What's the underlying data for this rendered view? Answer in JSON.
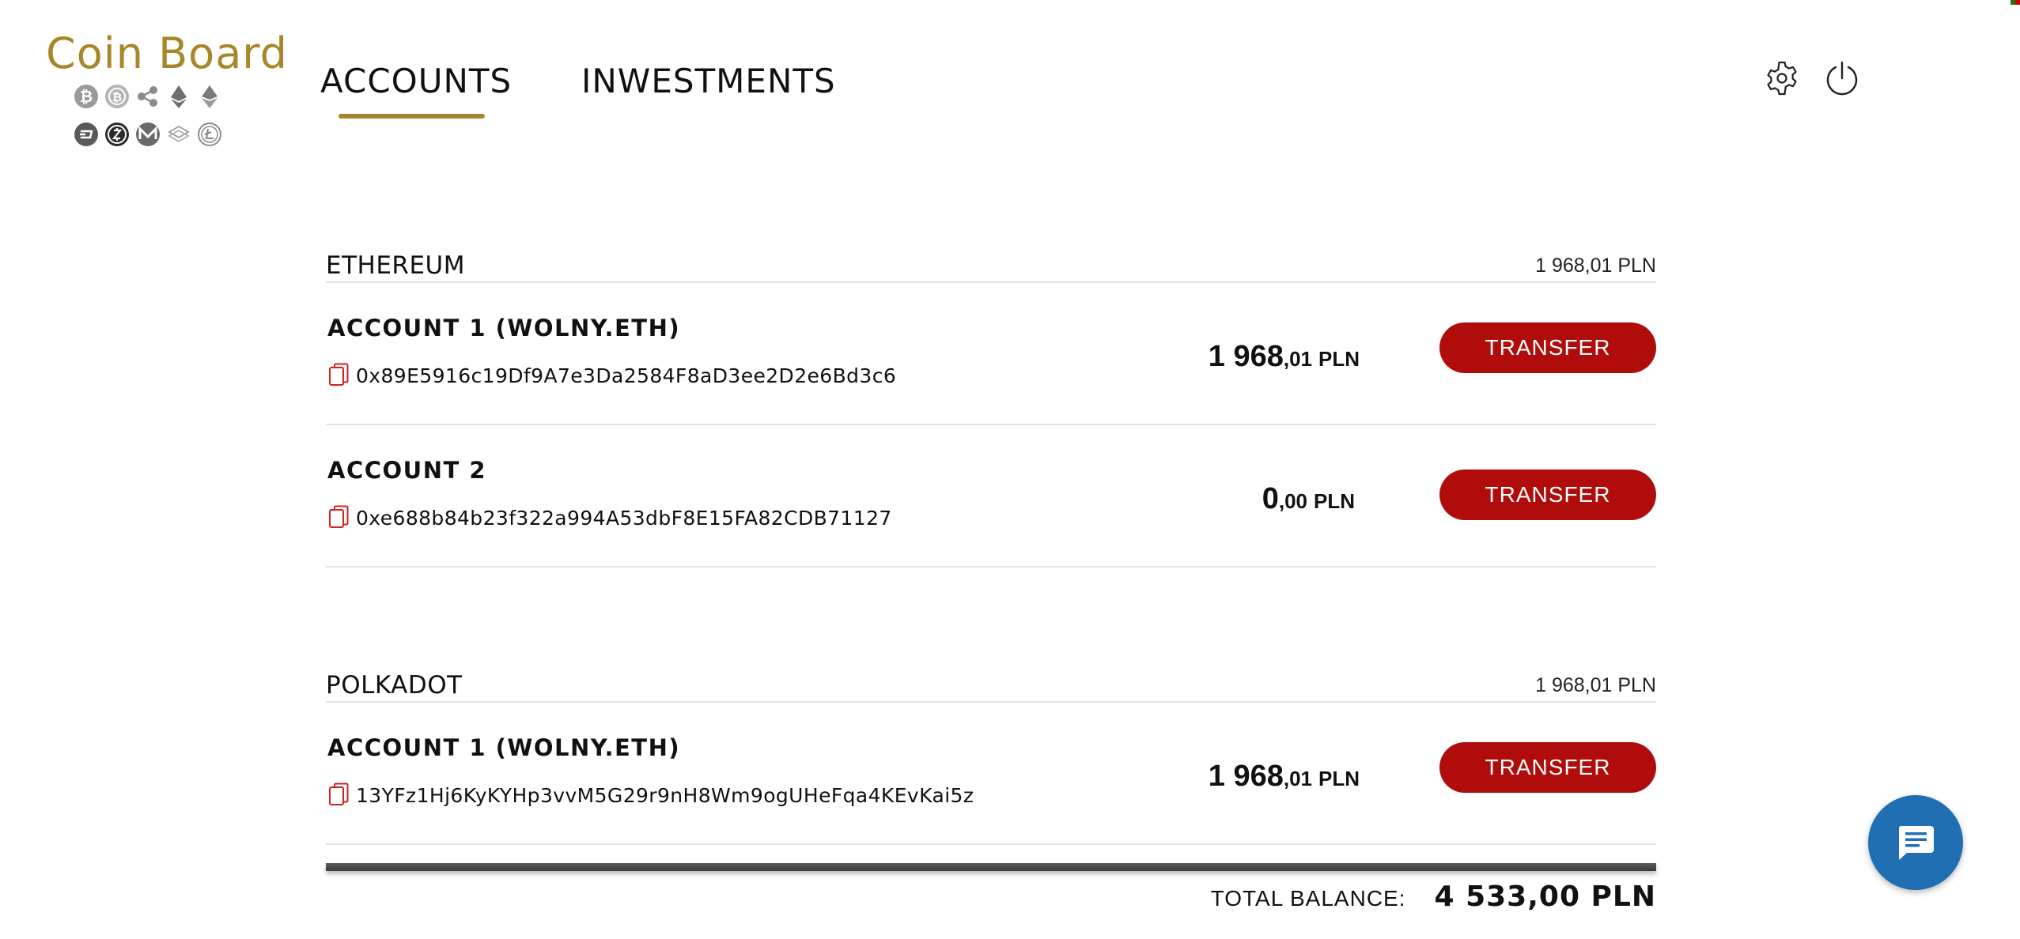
{
  "app": {
    "logo_title": "Coin Board",
    "brand_color": "#a8872a",
    "accent_color": "#b00c0c",
    "chat_color": "#1f6fb2"
  },
  "coins": {
    "row1": [
      "bitcoin-icon",
      "bitcoin-cash-icon",
      "ripple-icon",
      "ethereum-icon",
      "ethereum-classic-icon"
    ],
    "row2": [
      "dash-icon",
      "zcash-icon",
      "monero-icon",
      "lisk-icon",
      "litecoin-icon"
    ]
  },
  "nav": {
    "tabs": [
      {
        "label": "ACCOUNTS",
        "active": true
      },
      {
        "label": "INWESTMENTS",
        "active": false
      }
    ]
  },
  "header_icons": [
    "gear-icon",
    "power-icon"
  ],
  "sections": [
    {
      "title": "ETHEREUM",
      "total": "1 968,01 PLN",
      "accounts": [
        {
          "name": "ACCOUNT 1 (WOLNY.ETH)",
          "address": "0x89E5916c19Df9A7e3Da2584F8aD3ee2D2e6Bd3c6",
          "balance_int": "1 968",
          "balance_dec": ",01",
          "currency": "PLN",
          "button": "TRANSFER"
        },
        {
          "name": "ACCOUNT 2",
          "address": "0xe688b84b23f322a994A53dbF8E15FA82CDB71127",
          "balance_int": "0",
          "balance_dec": ",00",
          "currency": "PLN",
          "button": "TRANSFER"
        }
      ]
    },
    {
      "title": "POLKADOT",
      "total": "1 968,01 PLN",
      "accounts": [
        {
          "name": "ACCOUNT 1 (WOLNY.ETH)",
          "address": "13YFz1Hj6KyKYHp3vvM5G29r9nH8Wm9ogUHeFqa4KEvKai5z",
          "balance_int": "1 968",
          "balance_dec": ",01",
          "currency": "PLN",
          "button": "TRANSFER"
        }
      ]
    }
  ],
  "footer": {
    "total_label": "TOTAL BALANCE:",
    "total_value": "4 533,00 PLN"
  },
  "chat": {
    "icon": "chat-icon"
  }
}
